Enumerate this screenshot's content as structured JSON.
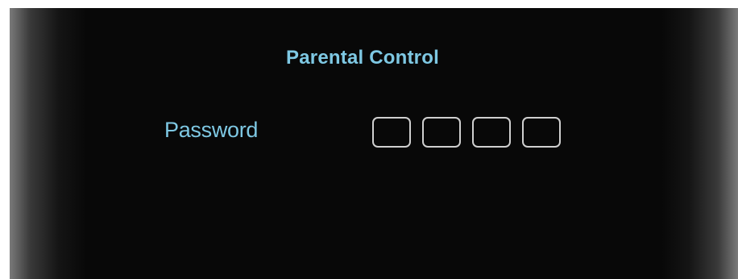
{
  "dialog": {
    "title": "Parental Control",
    "password_label": "Password",
    "pin": {
      "digits": [
        "",
        "",
        "",
        ""
      ]
    }
  },
  "colors": {
    "accent_text": "#7ec8e3",
    "background": "#080808",
    "box_border": "#cfcfcf"
  }
}
